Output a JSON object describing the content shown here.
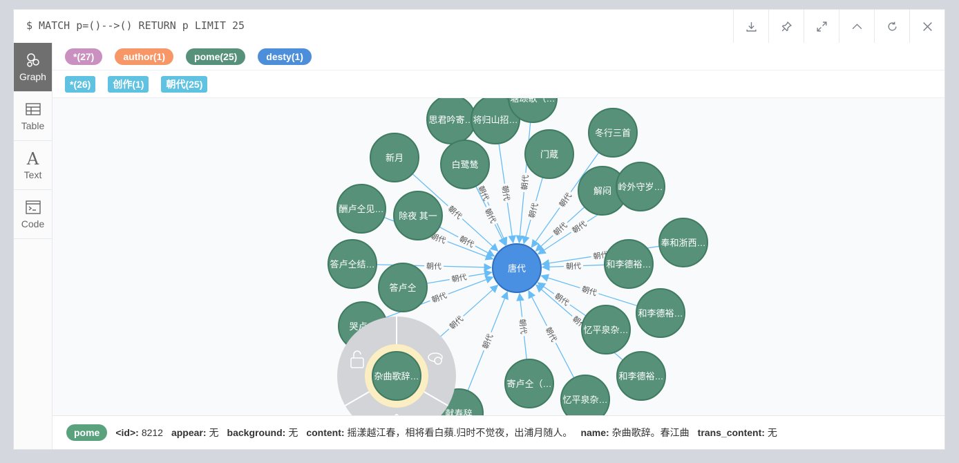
{
  "query": "$ MATCH p=()-->() RETURN p LIMIT 25",
  "toolbar": [
    "download-icon",
    "pin-icon",
    "expand-icon",
    "collapse-up-icon",
    "refresh-icon",
    "close-icon"
  ],
  "nav": [
    {
      "label": "Graph",
      "icon": "graph-icon",
      "active": true
    },
    {
      "label": "Table",
      "icon": "table-icon",
      "active": false
    },
    {
      "label": "Text",
      "icon": "text-icon",
      "active": false
    },
    {
      "label": "Code",
      "icon": "code-icon",
      "active": false
    }
  ],
  "node_labels": [
    {
      "text": "*(27)",
      "color": "#c990c0"
    },
    {
      "text": "author(1)",
      "color": "#f79767"
    },
    {
      "text": "pome(25)",
      "color": "#57917a"
    },
    {
      "text": "desty(1)",
      "color": "#4c8eda"
    }
  ],
  "rel_types": [
    {
      "text": "*(26)",
      "color": "#5ec2e0"
    },
    {
      "text": "创作(1)",
      "color": "#5ec2e0"
    },
    {
      "text": "朝代(25)",
      "color": "#5ec2e0"
    }
  ],
  "graph": {
    "center": {
      "label": "唐代",
      "color": "#4a90e2"
    },
    "edge_label": "朝代",
    "node_color": "#57917a",
    "nodes": [
      "思君吟寄…",
      "将归山招…",
      "塘颂歌（…",
      "冬行三首",
      "新月",
      "白鹭鸶",
      "门蔵",
      "解闷",
      "岭外守岁…",
      "酬卢仝见…",
      "除夜 其一",
      "奉和浙西…",
      "答卢仝结…",
      "和李德裕…",
      "答卢仝",
      "和李德裕…",
      "哭卢…",
      "忆平泉杂…",
      "和李德裕…",
      "寄卢仝（…",
      "忆平泉杂…",
      "献寿辞",
      "杂曲歌辞…"
    ],
    "selected": "杂曲歌辞…"
  },
  "footer": {
    "label": "pome",
    "props": [
      {
        "key": "<id>:",
        "value": "8212"
      },
      {
        "key": "appear:",
        "value": "无"
      },
      {
        "key": "background:",
        "value": "无"
      },
      {
        "key": "content:",
        "value": "摇漾越江春，相将看白蘋.归时不觉夜，出浦月随人。"
      },
      {
        "key": "name:",
        "value": "杂曲歌辞。春江曲"
      },
      {
        "key": "trans_content:",
        "value": "无"
      }
    ]
  }
}
